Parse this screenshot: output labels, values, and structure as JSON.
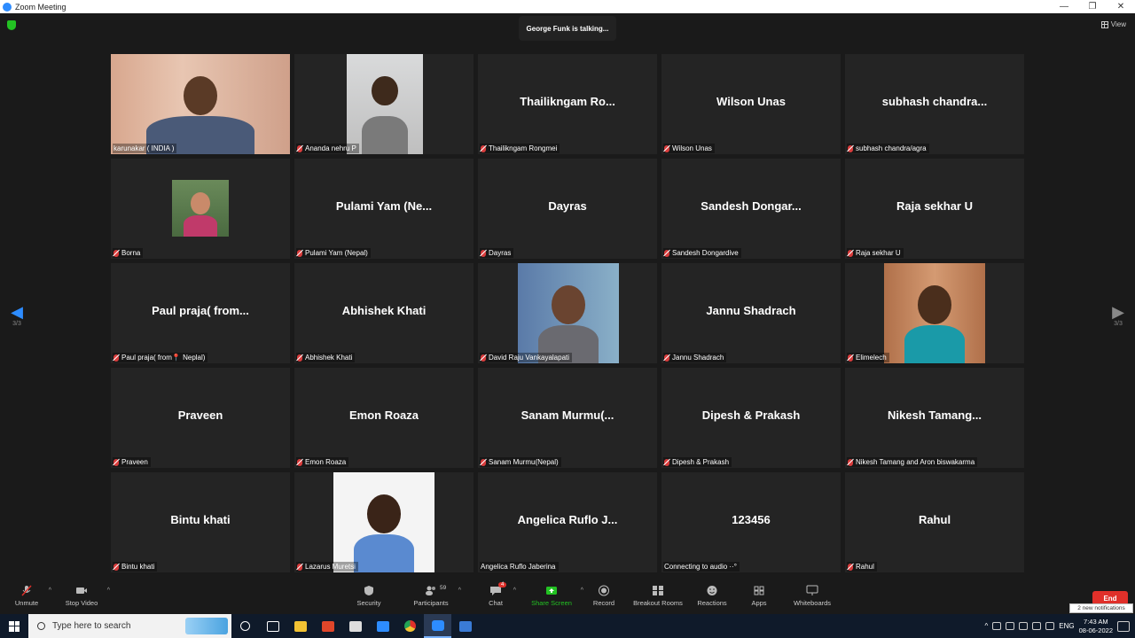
{
  "window": {
    "title": "Zoom Meeting",
    "controls": [
      "—",
      "❐",
      "✕"
    ]
  },
  "top": {
    "talking": "George Funk is talking...",
    "view_label": "View"
  },
  "pager": {
    "left": "3/3",
    "right": "3/3"
  },
  "tiles": [
    {
      "big": "",
      "label": "karunakar ( INDIA )",
      "muted": false
    },
    {
      "big": "",
      "label": "Ananda nehru  P",
      "muted": true
    },
    {
      "big": "Thailikngam  Ro...",
      "label": "Thailikngam Rongmei",
      "muted": true
    },
    {
      "big": "Wilson Unas",
      "label": "Wilson Unas",
      "muted": true
    },
    {
      "big": "subhash  chandra...",
      "label": "subhash chandra/agra",
      "muted": true
    },
    {
      "big": "",
      "label": "Borna",
      "muted": true
    },
    {
      "big": "Pulami  Yam  (Ne...",
      "label": "Pulami Yam (Nepal)",
      "muted": true
    },
    {
      "big": "Dayras",
      "label": "Dayras",
      "muted": true
    },
    {
      "big": "Sandesh  Dongar...",
      "label": "Sandesh Dongardive",
      "muted": true
    },
    {
      "big": "Raja sekhar U",
      "label": "Raja sekhar U",
      "muted": true
    },
    {
      "big": "Paul  praja(  from...",
      "label": "Paul praja( from📍 Neplal)",
      "muted": true
    },
    {
      "big": "Abhishek Khati",
      "label": "Abhishek Khati",
      "muted": true
    },
    {
      "big": "",
      "label": "David Raju Vankayalapati",
      "muted": true
    },
    {
      "big": "Jannu Shadrach",
      "label": "Jannu Shadrach",
      "muted": true
    },
    {
      "big": "",
      "label": "Elimelech",
      "muted": true
    },
    {
      "big": "Praveen",
      "label": "Praveen",
      "muted": true
    },
    {
      "big": "Emon Roaza",
      "label": "Emon Roaza",
      "muted": true
    },
    {
      "big": "Sanam  Murmu(...",
      "label": "Sanam Murmu(Nepal)",
      "muted": true
    },
    {
      "big": "Dipesh & Prakash",
      "label": "Dipesh & Prakash",
      "muted": true
    },
    {
      "big": "Nikesh  Tamang...",
      "label": "Nikesh Tamang and Aron biswakarma",
      "muted": true
    },
    {
      "big": "Bintu khati",
      "label": "Bintu khati",
      "muted": true
    },
    {
      "big": "",
      "label": "Lazarus Muretsi",
      "muted": true
    },
    {
      "big": "Angelica  Ruflo  J...",
      "label": "Angelica Ruflo Jaberina",
      "muted": false
    },
    {
      "big": "123456",
      "label": "Connecting to audio ··°",
      "muted": false
    },
    {
      "big": "Rahul",
      "label": "Rahul",
      "muted": true
    }
  ],
  "toolbar": {
    "unmute": "Unmute",
    "stop_video": "Stop Video",
    "security": "Security",
    "participants": "Participants",
    "participants_count": "59",
    "chat": "Chat",
    "chat_badge": "4",
    "share_screen": "Share Screen",
    "record": "Record",
    "breakout": "Breakout Rooms",
    "reactions": "Reactions",
    "apps": "Apps",
    "whiteboards": "Whiteboards",
    "end": "End",
    "notification": "2 new notifications"
  },
  "taskbar": {
    "search_placeholder": "Type here to search",
    "lang": "ENG",
    "time": "7:43 AM",
    "date": "08-06-2022"
  },
  "colors": {
    "accent": "#2d8cff",
    "end": "#e0302a",
    "share": "#23c223",
    "tile_bg": "#242424"
  }
}
